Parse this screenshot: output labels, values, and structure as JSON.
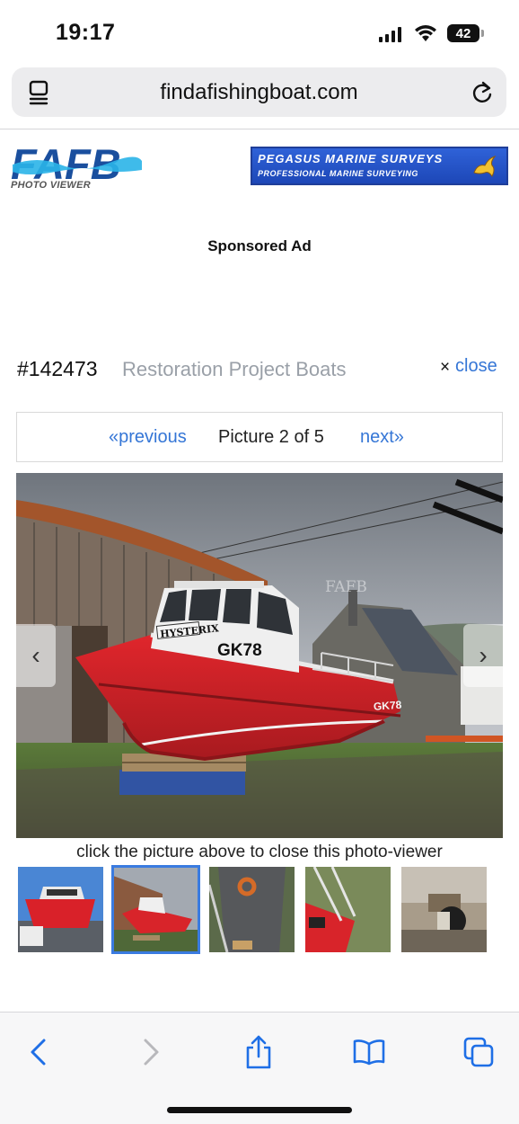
{
  "status_bar": {
    "time": "19:17",
    "battery": "42"
  },
  "browser": {
    "url": "findafishingboat.com",
    "toolbar": [
      "back",
      "forward",
      "share",
      "bookmarks",
      "tabs"
    ]
  },
  "site": {
    "logo_text": "FAFB",
    "logo_subtitle": "PHOTO VIEWER",
    "ad_title": "PEGASUS MARINE SURVEYS",
    "ad_subtitle": "PROFESSIONAL MARINE SURVEYING",
    "sponsored": "Sponsored Ad"
  },
  "viewer": {
    "listing_id": "#142473",
    "title": "Restoration Project Boats",
    "close_icon": "×",
    "close_label": "close",
    "prev_label": "«previous",
    "picture_count": "Picture 2 of 5",
    "next_label": "next»",
    "hint": "click the picture above to close this photo-viewer",
    "main_photo": {
      "boat_name": "HYSTERIX",
      "reg": "GK78",
      "watermark": "FAFB"
    },
    "thumbnails": [
      {
        "label": "thumb-1",
        "active": false
      },
      {
        "label": "thumb-2",
        "active": true
      },
      {
        "label": "thumb-3",
        "active": false
      },
      {
        "label": "thumb-4",
        "active": false
      },
      {
        "label": "thumb-5",
        "active": false
      }
    ]
  },
  "colors": {
    "link": "#3576d6",
    "hull_red": "#d8242a",
    "active_thumb": "#3a7be0"
  }
}
